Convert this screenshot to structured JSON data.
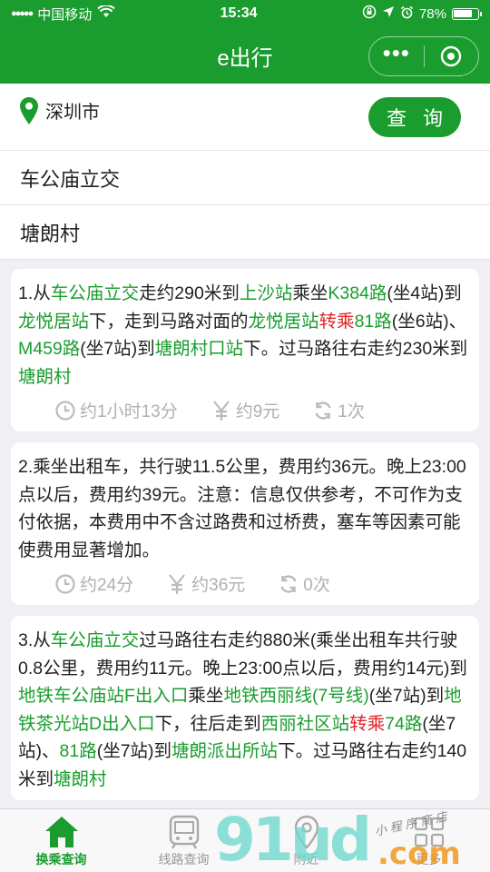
{
  "status_bar": {
    "carrier": "中国移动",
    "time": "15:34",
    "battery": "78%",
    "battery_level": 0.78
  },
  "nav": {
    "title": "e出行"
  },
  "search": {
    "city": "深圳市",
    "query_button": "查 询",
    "origin": "车公庙立交",
    "destination": "塘朗村"
  },
  "results": [
    {
      "segments": [
        {
          "t": "1.从"
        },
        {
          "t": "车公庙立交",
          "c": "g"
        },
        {
          "t": "走约290米到"
        },
        {
          "t": "上沙站",
          "c": "g"
        },
        {
          "t": "乘坐"
        },
        {
          "t": "K384路",
          "c": "g"
        },
        {
          "t": "(坐4站)到"
        },
        {
          "t": "龙悦居站",
          "c": "g"
        },
        {
          "t": "下，走到马路对面的"
        },
        {
          "t": "龙悦居站",
          "c": "g"
        },
        {
          "t": "转乘",
          "c": "r"
        },
        {
          "t": "81路",
          "c": "g"
        },
        {
          "t": "(坐6站)、"
        },
        {
          "t": "M459路",
          "c": "g"
        },
        {
          "t": "(坐7站)到"
        },
        {
          "t": "塘朗村口站",
          "c": "g"
        },
        {
          "t": "下。过马路往右走约230米到"
        },
        {
          "t": "塘朗村",
          "c": "g"
        }
      ],
      "time": "约1小时13分",
      "cost": "约9元",
      "transfers": "1次"
    },
    {
      "segments": [
        {
          "t": "2.乘坐出租车，共行驶11.5公里，费用约36元。晚上23:00点以后，费用约39元。注意：信息仅供参考，不可作为支付依据，本费用中不含过路费和过桥费，塞车等因素可能使费用显著增加。"
        }
      ],
      "time": "约24分",
      "cost": "约36元",
      "transfers": "0次"
    },
    {
      "segments": [
        {
          "t": "3.从"
        },
        {
          "t": "车公庙立交",
          "c": "g"
        },
        {
          "t": "过马路往右走约880米(乘坐出租车共行驶0.8公里，费用约11元。晚上23:00点以后，费用约14元)到"
        },
        {
          "t": "地铁车公庙站F出入口",
          "c": "g"
        },
        {
          "t": "乘坐"
        },
        {
          "t": "地铁西丽线(7号线)",
          "c": "g"
        },
        {
          "t": "(坐7站)到"
        },
        {
          "t": "地铁茶光站D出入口",
          "c": "g"
        },
        {
          "t": "下，往后走到"
        },
        {
          "t": "西丽社区站",
          "c": "g"
        },
        {
          "t": "转乘",
          "c": "r"
        },
        {
          "t": "74路",
          "c": "g"
        },
        {
          "t": "(坐7站)、"
        },
        {
          "t": "81路",
          "c": "g"
        },
        {
          "t": "(坐7站)到"
        },
        {
          "t": "塘朗派出所站",
          "c": "g"
        },
        {
          "t": "下。过马路往右走约140米到"
        },
        {
          "t": "塘朗村",
          "c": "g"
        }
      ]
    }
  ],
  "tabs": [
    {
      "label": "换乘查询",
      "icon": "home-icon",
      "active": true
    },
    {
      "label": "线路查询",
      "icon": "bus-icon",
      "active": false
    },
    {
      "label": "附近",
      "icon": "location-icon",
      "active": false
    },
    {
      "label": "更多",
      "icon": "more-icon",
      "active": false
    }
  ],
  "watermark": {
    "number": "91ud",
    "suffix": ".com",
    "tagline": "小程序商店"
  },
  "colors": {
    "brand_green": "#1a9d2e",
    "highlight_green": "#1a9d2e",
    "transfer_red": "#e0262a",
    "meta_gray": "#b0b0b0"
  }
}
